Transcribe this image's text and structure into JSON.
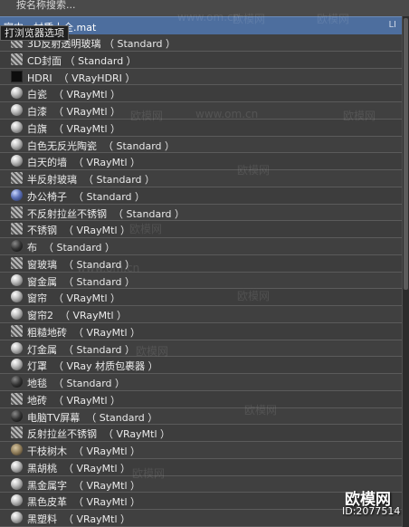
{
  "search_placeholder": "按名称搜索...",
  "path": "室内vr材质大全.mat",
  "path_suffix": "LI",
  "tooltip": "打浏览器选项",
  "watermark": "欧模网",
  "watermark_url": "www.om.cn",
  "logo_text": "欧模网",
  "logo_id": "ID:2077514",
  "materials": [
    {
      "label": "3D反射透明玻璃 （ Standard ）",
      "swatch": "grid"
    },
    {
      "label": "CD封面 （ Standard ）",
      "swatch": "grid"
    },
    {
      "label": "HDRI  （ VRayHDRI ）",
      "swatch": "flat"
    },
    {
      "label": "白瓷  （ VRayMtl ）",
      "swatch": "sphere"
    },
    {
      "label": "白漆  （ VRayMtl ）",
      "swatch": "sphere"
    },
    {
      "label": "白旗  （ VRayMtl ）",
      "swatch": "sphere"
    },
    {
      "label": "白色无反光陶瓷  （ Standard ）",
      "swatch": "sphere"
    },
    {
      "label": "白天的墙  （ VRayMtl ）",
      "swatch": "sphere"
    },
    {
      "label": "半反射玻璃  （ Standard ）",
      "swatch": "grid"
    },
    {
      "label": "办公椅子  （ Standard ）",
      "swatch": "blue"
    },
    {
      "label": "不反射拉丝不锈钢  （ Standard ）",
      "swatch": "grid"
    },
    {
      "label": "不锈钢  （ VRayMtl ）",
      "swatch": "grid"
    },
    {
      "label": "布  （ Standard ）",
      "swatch": "dark"
    },
    {
      "label": "窗玻璃  （ Standard ）",
      "swatch": "grid"
    },
    {
      "label": "窗金属  （ Standard ）",
      "swatch": "sphere"
    },
    {
      "label": "窗帘  （ VRayMtl ）",
      "swatch": "sphere"
    },
    {
      "label": "窗帘2  （ VRayMtl ）",
      "swatch": "sphere"
    },
    {
      "label": "粗糙地砖  （ VRayMtl ）",
      "swatch": "grid"
    },
    {
      "label": "灯金属  （ Standard ）",
      "swatch": "sphere"
    },
    {
      "label": "灯罩  （ VRay 材质包裹器 ）",
      "swatch": "sphere"
    },
    {
      "label": "地毯  （ Standard ）",
      "swatch": "dark"
    },
    {
      "label": "地砖  （ VRayMtl ）",
      "swatch": "grid"
    },
    {
      "label": "电脑TV屏幕  （ Standard ）",
      "swatch": "dark"
    },
    {
      "label": "反射拉丝不锈钢  （ VRayMtl ）",
      "swatch": "grid"
    },
    {
      "label": "干枝树木  （ VRayMtl ）",
      "swatch": "tex"
    },
    {
      "label": "黑胡桃  （ VRayMtl ）",
      "swatch": "sphere"
    },
    {
      "label": "黑金属字  （ VRayMtl ）",
      "swatch": "sphere"
    },
    {
      "label": "黑色皮革  （ VRayMtl ）",
      "swatch": "sphere"
    },
    {
      "label": "黑塑料  （ VRayMtl ）",
      "swatch": "sphere"
    }
  ]
}
